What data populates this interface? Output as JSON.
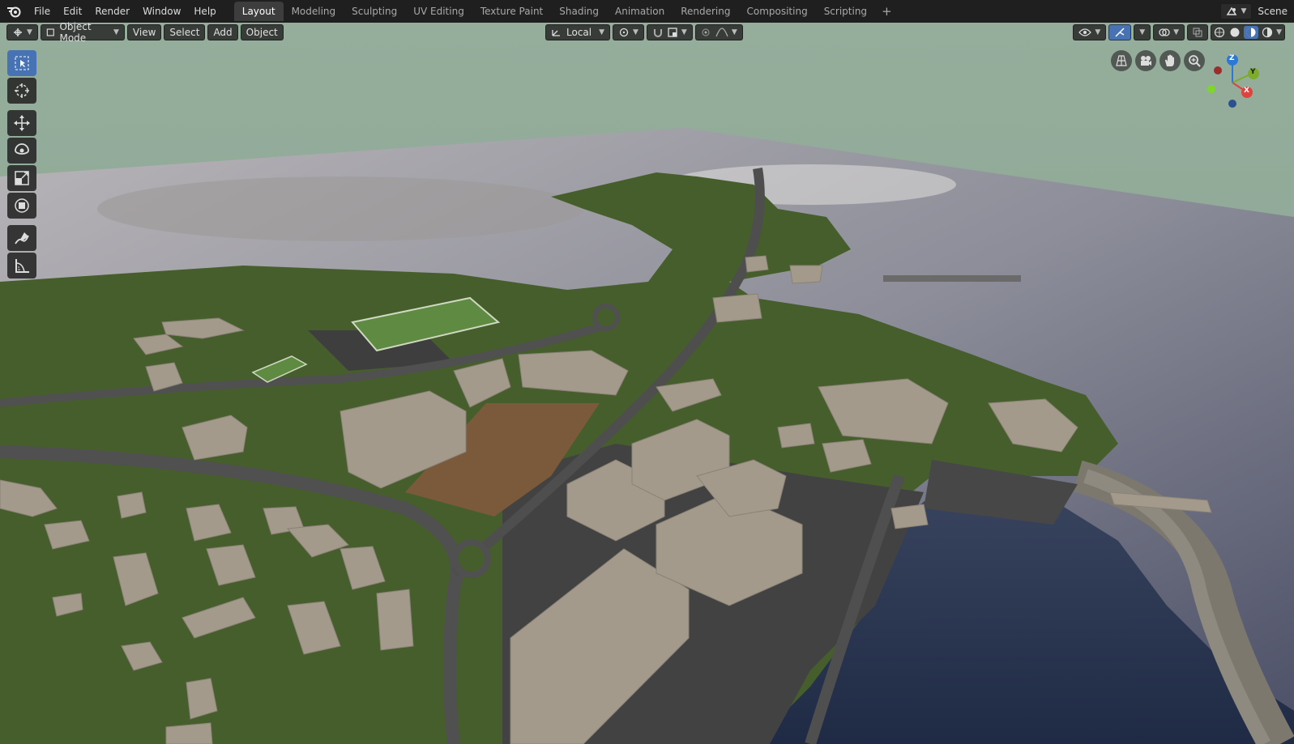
{
  "app": {
    "logo_icon": "blender-logo-icon",
    "menu": [
      "File",
      "Edit",
      "Render",
      "Window",
      "Help"
    ],
    "workspace_tabs": [
      "Layout",
      "Modeling",
      "Sculpting",
      "UV Editing",
      "Texture Paint",
      "Shading",
      "Animation",
      "Rendering",
      "Compositing",
      "Scripting"
    ],
    "active_tab": "Layout",
    "add_tab_icon": "plus-icon",
    "scene_name": "Scene"
  },
  "viewport_header": {
    "mode": "Object Mode",
    "menus": [
      "View",
      "Select",
      "Add",
      "Object"
    ],
    "transform_orientation": "Local",
    "accent_color": "#4772b3"
  },
  "toolbar": {
    "tools": [
      "select-box-icon",
      "cursor-icon",
      "move-icon",
      "rotate-icon",
      "scale-icon",
      "transform-icon",
      "annotate-icon",
      "measure-icon"
    ],
    "active_tool": "select-box-icon"
  },
  "navigation_gizmo": {
    "axes": [
      "Z",
      "Y",
      "X"
    ],
    "colors": {
      "x": "#e0423d",
      "y": "#7dab2a",
      "z": "#2b78d6"
    }
  },
  "scene_colors": {
    "sky": "#8fa897",
    "grass": "#465e2c",
    "water": "#2a3550",
    "roads": "#454545",
    "buildings": "#a19788"
  }
}
